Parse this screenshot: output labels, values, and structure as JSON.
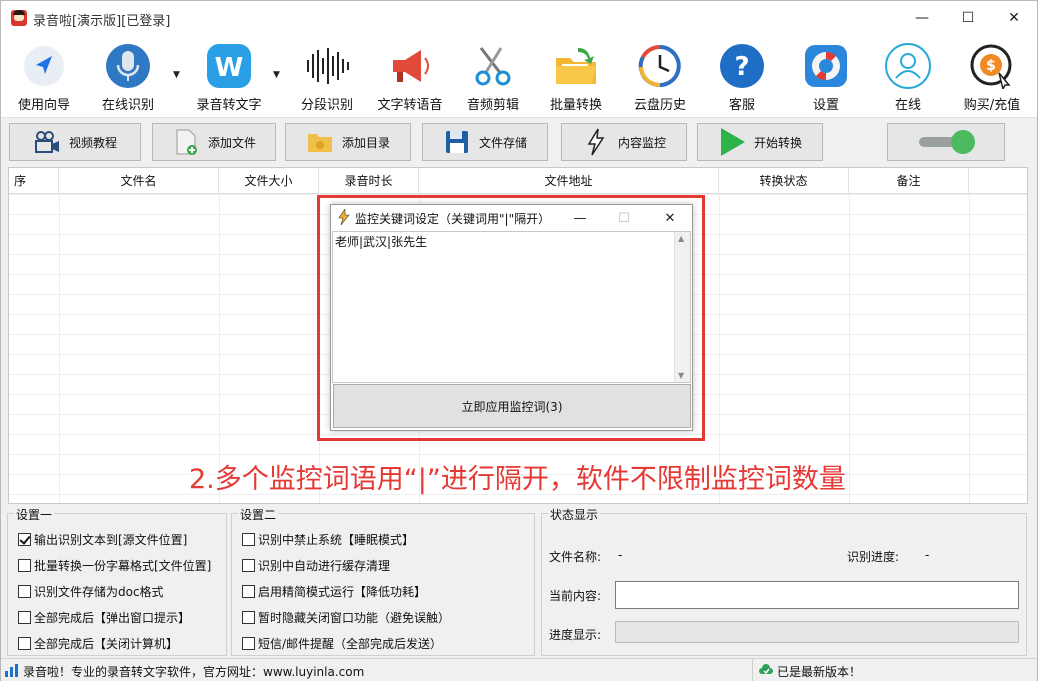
{
  "window": {
    "title": "录音啦[演示版][已登录]",
    "minimize": "—",
    "maximize": "☐",
    "close": "✕"
  },
  "toolbar": [
    {
      "label": "使用向导",
      "icon": "compass-arrow-icon"
    },
    {
      "label": "在线识别",
      "icon": "microphone-icon"
    },
    {
      "label": "录音转文字",
      "icon": "w-logo-icon"
    },
    {
      "label": "分段识别",
      "icon": "soundwave-icon"
    },
    {
      "label": "文字转语音",
      "icon": "megaphone-icon"
    },
    {
      "label": "音频剪辑",
      "icon": "scissors-icon"
    },
    {
      "label": "批量转换",
      "icon": "folder-arrow-icon"
    },
    {
      "label": "云盘历史",
      "icon": "history-clock-icon"
    },
    {
      "label": "客服",
      "icon": "question-icon"
    },
    {
      "label": "设置",
      "icon": "lifebuoy-icon"
    },
    {
      "label": "在线",
      "icon": "user-outline-icon"
    },
    {
      "label": "购买/充值",
      "icon": "dollar-coin-icon"
    }
  ],
  "actions": {
    "video": "视频教程",
    "add_file": "添加文件",
    "add_dir": "添加目录",
    "save": "文件存储",
    "monitor": "内容监控",
    "start": "开始转换"
  },
  "toggle": {
    "on": true,
    "color": "#4cbb5f"
  },
  "table": {
    "columns": [
      "序",
      "文件名",
      "文件大小",
      "录音时长",
      "文件地址",
      "转换状态",
      "备注"
    ]
  },
  "dialog": {
    "title": "监控关键词设定（关键词用\"|\"隔开）",
    "keywords": "老师|武汉|张先生",
    "apply_button": "立即应用监控词(3)",
    "minimize": "—",
    "maximize": "☐",
    "close": "✕"
  },
  "annotation": "2.多个监控词语用“|”进行隔开，软件不限制监控词数量",
  "settings1": {
    "title": "设置一",
    "options": [
      {
        "label": "输出识别文本到[源文件位置]",
        "checked": true
      },
      {
        "label": "批量转换一份字幕格式[文件位置]",
        "checked": false
      },
      {
        "label": "识别文件存储为doc格式",
        "checked": false
      },
      {
        "label": "全部完成后【弹出窗口提示】",
        "checked": false
      },
      {
        "label": "全部完成后【关闭计算机】",
        "checked": false
      }
    ]
  },
  "settings2": {
    "title": "设置二",
    "options": [
      {
        "label": "识别中禁止系统【睡眠模式】",
        "checked": false
      },
      {
        "label": "识别中自动进行缓存清理",
        "checked": false
      },
      {
        "label": "启用精简模式运行【降低功耗】",
        "checked": false
      },
      {
        "label": "暂时隐藏关闭窗口功能（避免误触）",
        "checked": false
      },
      {
        "label": "短信/邮件提醒（全部完成后发送）",
        "checked": false
      }
    ]
  },
  "status": {
    "title": "状态显示",
    "file_name_label": "文件名称:",
    "file_name_value": "-",
    "progress_label": "识别进度:",
    "progress_value": "-",
    "current_label": "当前内容:",
    "current_value": "",
    "bar_label": "进度显示:",
    "bar_fraction": 0
  },
  "statusbar": {
    "left": "录音啦！专业的录音转文字软件，官方网址：www.luyinla.com",
    "right": "已是最新版本！"
  }
}
